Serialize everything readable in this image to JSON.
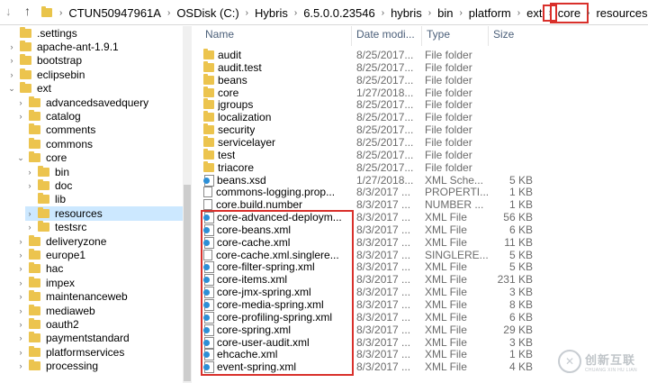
{
  "address": {
    "crumbs": [
      "CTUN50947961A",
      "OSDisk (C:)",
      "Hybris",
      "6.5.0.0.23546",
      "hybris",
      "bin",
      "platform",
      "ext",
      "core",
      "resources"
    ],
    "back_icon": "back-arrow-icon",
    "up_icon": "up-arrow-icon",
    "highlight_color": "#d9302b"
  },
  "tree": [
    {
      "label": ".settings",
      "indent": 0,
      "expander": ""
    },
    {
      "label": "apache-ant-1.9.1",
      "indent": 0,
      "expander": ">"
    },
    {
      "label": "bootstrap",
      "indent": 0,
      "expander": ">"
    },
    {
      "label": "eclipsebin",
      "indent": 0,
      "expander": ">"
    },
    {
      "label": "ext",
      "indent": 0,
      "expander": "v"
    },
    {
      "label": "advancedsavedquery",
      "indent": 1,
      "expander": ">"
    },
    {
      "label": "catalog",
      "indent": 1,
      "expander": ">"
    },
    {
      "label": "comments",
      "indent": 1,
      "expander": ""
    },
    {
      "label": "commons",
      "indent": 1,
      "expander": ""
    },
    {
      "label": "core",
      "indent": 1,
      "expander": "v"
    },
    {
      "label": "bin",
      "indent": 2,
      "expander": ">"
    },
    {
      "label": "doc",
      "indent": 2,
      "expander": ">"
    },
    {
      "label": "lib",
      "indent": 2,
      "expander": ""
    },
    {
      "label": "resources",
      "indent": 2,
      "expander": ">",
      "selected": true
    },
    {
      "label": "testsrc",
      "indent": 2,
      "expander": ">"
    },
    {
      "label": "deliveryzone",
      "indent": 1,
      "expander": ">"
    },
    {
      "label": "europe1",
      "indent": 1,
      "expander": ">"
    },
    {
      "label": "hac",
      "indent": 1,
      "expander": ">"
    },
    {
      "label": "impex",
      "indent": 1,
      "expander": ">"
    },
    {
      "label": "maintenanceweb",
      "indent": 1,
      "expander": ">"
    },
    {
      "label": "mediaweb",
      "indent": 1,
      "expander": ">"
    },
    {
      "label": "oauth2",
      "indent": 1,
      "expander": ">"
    },
    {
      "label": "paymentstandard",
      "indent": 1,
      "expander": ">"
    },
    {
      "label": "platformservices",
      "indent": 1,
      "expander": ">"
    },
    {
      "label": "processing",
      "indent": 1,
      "expander": ">"
    }
  ],
  "columns": {
    "name": "Name",
    "date": "Date modi...",
    "type": "Type",
    "size": "Size"
  },
  "files": [
    {
      "name": "audit",
      "date": "8/25/2017...",
      "type": "File folder",
      "size": "",
      "icon": "folder"
    },
    {
      "name": "audit.test",
      "date": "8/25/2017...",
      "type": "File folder",
      "size": "",
      "icon": "folder"
    },
    {
      "name": "beans",
      "date": "8/25/2017...",
      "type": "File folder",
      "size": "",
      "icon": "folder"
    },
    {
      "name": "core",
      "date": "1/27/2018...",
      "type": "File folder",
      "size": "",
      "icon": "folder"
    },
    {
      "name": "jgroups",
      "date": "8/25/2017...",
      "type": "File folder",
      "size": "",
      "icon": "folder"
    },
    {
      "name": "localization",
      "date": "8/25/2017...",
      "type": "File folder",
      "size": "",
      "icon": "folder"
    },
    {
      "name": "security",
      "date": "8/25/2017...",
      "type": "File folder",
      "size": "",
      "icon": "folder"
    },
    {
      "name": "servicelayer",
      "date": "8/25/2017...",
      "type": "File folder",
      "size": "",
      "icon": "folder"
    },
    {
      "name": "test",
      "date": "8/25/2017...",
      "type": "File folder",
      "size": "",
      "icon": "folder"
    },
    {
      "name": "triacore",
      "date": "8/25/2017...",
      "type": "File folder",
      "size": "",
      "icon": "folder"
    },
    {
      "name": "beans.xsd",
      "date": "1/27/2018...",
      "type": "XML Sche...",
      "size": "5 KB",
      "icon": "xml"
    },
    {
      "name": "commons-logging.prop...",
      "date": "8/3/2017 ...",
      "type": "PROPERTI...",
      "size": "1 KB",
      "icon": "doc"
    },
    {
      "name": "core.build.number",
      "date": "8/3/2017 ...",
      "type": "NUMBER ...",
      "size": "1 KB",
      "icon": "doc"
    },
    {
      "name": "core-advanced-deploym...",
      "date": "8/3/2017 ...",
      "type": "XML File",
      "size": "56 KB",
      "icon": "xml"
    },
    {
      "name": "core-beans.xml",
      "date": "8/3/2017 ...",
      "type": "XML File",
      "size": "6 KB",
      "icon": "xml"
    },
    {
      "name": "core-cache.xml",
      "date": "8/3/2017 ...",
      "type": "XML File",
      "size": "11 KB",
      "icon": "xml"
    },
    {
      "name": "core-cache.xml.singlere...",
      "date": "8/3/2017 ...",
      "type": "SINGLERE...",
      "size": "5 KB",
      "icon": "doc"
    },
    {
      "name": "core-filter-spring.xml",
      "date": "8/3/2017 ...",
      "type": "XML File",
      "size": "5 KB",
      "icon": "xml"
    },
    {
      "name": "core-items.xml",
      "date": "8/3/2017 ...",
      "type": "XML File",
      "size": "231 KB",
      "icon": "xml"
    },
    {
      "name": "core-jmx-spring.xml",
      "date": "8/3/2017 ...",
      "type": "XML File",
      "size": "3 KB",
      "icon": "xml"
    },
    {
      "name": "core-media-spring.xml",
      "date": "8/3/2017 ...",
      "type": "XML File",
      "size": "8 KB",
      "icon": "xml"
    },
    {
      "name": "core-profiling-spring.xml",
      "date": "8/3/2017 ...",
      "type": "XML File",
      "size": "6 KB",
      "icon": "xml"
    },
    {
      "name": "core-spring.xml",
      "date": "8/3/2017 ...",
      "type": "XML File",
      "size": "29 KB",
      "icon": "xml"
    },
    {
      "name": "core-user-audit.xml",
      "date": "8/3/2017 ...",
      "type": "XML File",
      "size": "3 KB",
      "icon": "xml"
    },
    {
      "name": "ehcache.xml",
      "date": "8/3/2017 ...",
      "type": "XML File",
      "size": "1 KB",
      "icon": "xml"
    },
    {
      "name": "event-spring.xml",
      "date": "8/3/2017 ...",
      "type": "XML File",
      "size": "4 KB",
      "icon": "xml"
    }
  ],
  "watermark": {
    "logo_glyph": "✕",
    "text_cn": "创新互联",
    "text_en": "CHUANG XIN HU LIAN"
  }
}
